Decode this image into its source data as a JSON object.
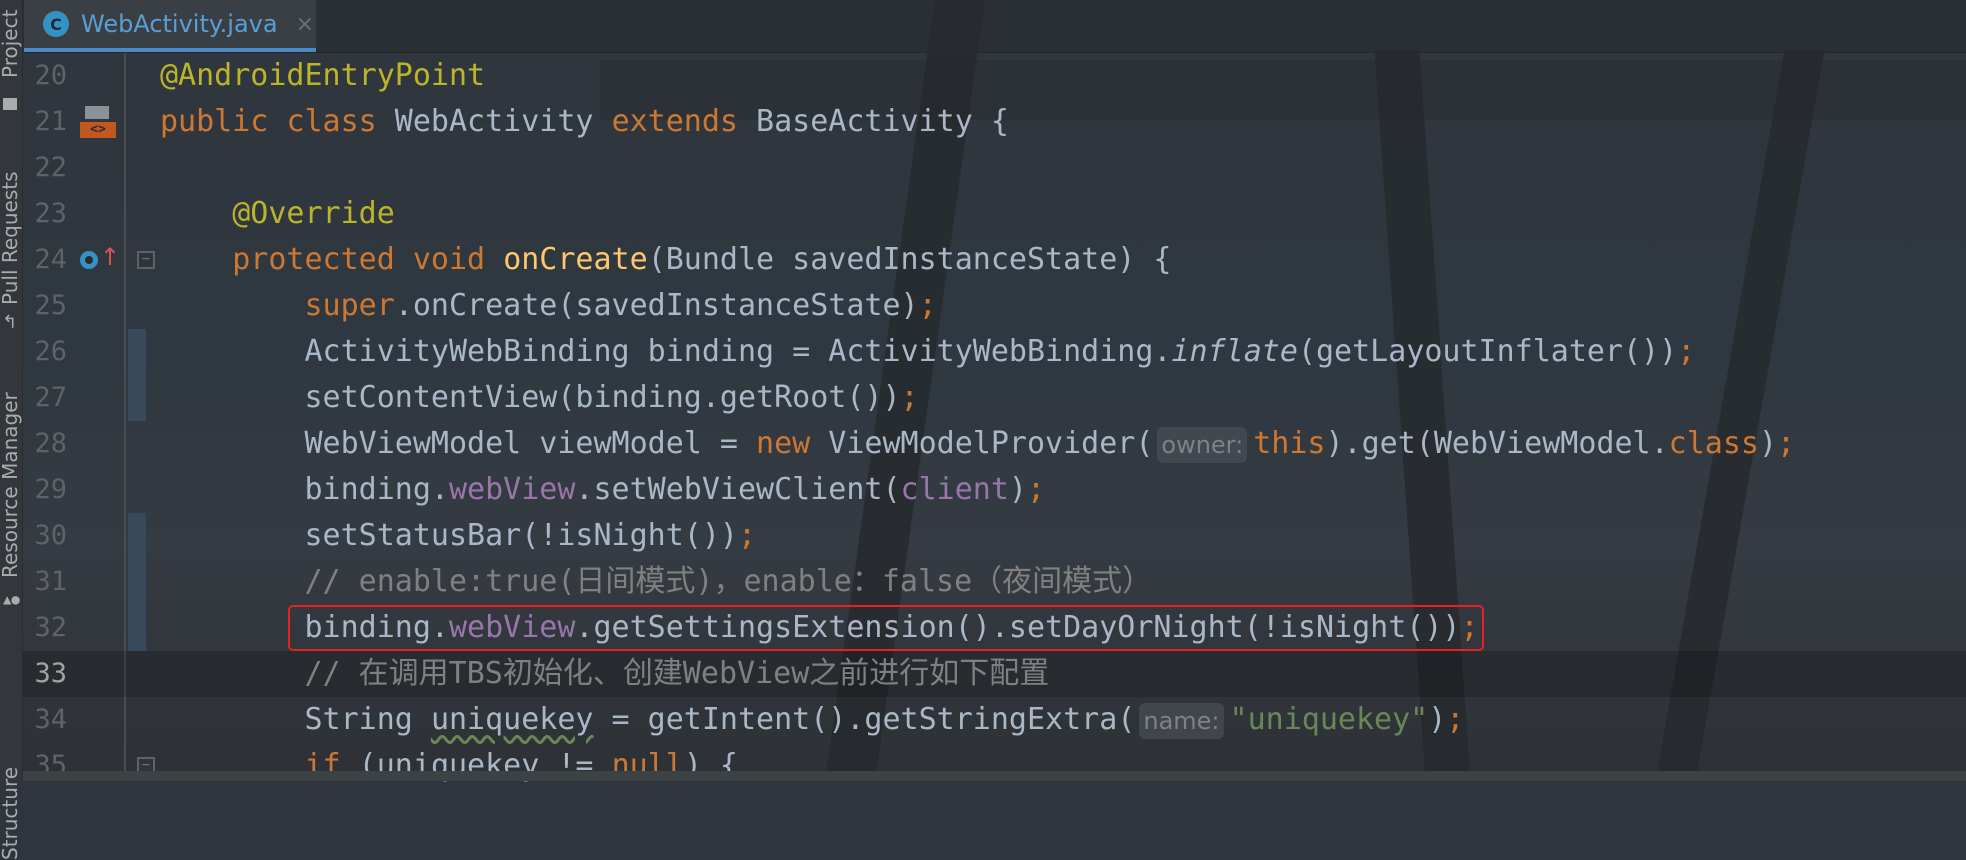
{
  "sidebar": {
    "items": [
      {
        "label": "Project",
        "icon": "folder-icon"
      },
      {
        "label": "Pull Requests",
        "icon": "pull-request-icon"
      },
      {
        "label": "Resource Manager",
        "icon": "resource-manager-icon"
      },
      {
        "label": "Structure",
        "icon": "structure-icon"
      }
    ]
  },
  "tab": {
    "label": "WebActivity.java",
    "icon_letter": "C",
    "close": "×"
  },
  "colors": {
    "annotation": "#bbb529",
    "keyword": "#cc7832",
    "plain": "#a9b7c6",
    "field": "#9876aa",
    "method": "#ffc66d",
    "comment": "#808080",
    "string": "#6a8759",
    "highlight_box": "#e82020",
    "tab_accent": "#4a88c7"
  },
  "current_line": 33,
  "highlighted_line": 32,
  "code": [
    {
      "n": "20",
      "tokens": [
        {
          "t": "@AndroidEntryPoint",
          "c": "ann"
        }
      ]
    },
    {
      "n": "21",
      "gutter": "implemented-icon",
      "tokens": [
        {
          "t": "public",
          "c": "kw"
        },
        {
          "t": " "
        },
        {
          "t": "class",
          "c": "kw"
        },
        {
          "t": " WebActivity "
        },
        {
          "t": "extends",
          "c": "kw"
        },
        {
          "t": " BaseActivity {"
        }
      ]
    },
    {
      "n": "22",
      "tokens": []
    },
    {
      "n": "23",
      "tokens": [
        {
          "t": "    "
        },
        {
          "t": "@Override",
          "c": "ann"
        }
      ]
    },
    {
      "n": "24",
      "gutter": "overrides-method-icon",
      "fold": true,
      "tokens": [
        {
          "t": "    "
        },
        {
          "t": "protected",
          "c": "kw"
        },
        {
          "t": " "
        },
        {
          "t": "void",
          "c": "kw"
        },
        {
          "t": " "
        },
        {
          "t": "onCreate",
          "c": "method"
        },
        {
          "t": "(Bundle savedInstanceState) {"
        }
      ]
    },
    {
      "n": "25",
      "tokens": [
        {
          "t": "        "
        },
        {
          "t": "super",
          "c": "kw"
        },
        {
          "t": ".onCreate(savedInstanceState)"
        },
        {
          "t": ";",
          "c": "kw"
        }
      ]
    },
    {
      "n": "26",
      "changed": true,
      "tokens": [
        {
          "t": "        ActivityWebBinding binding = ActivityWebBinding."
        },
        {
          "t": "inflate",
          "c": "italic"
        },
        {
          "t": "(getLayoutInflater())"
        },
        {
          "t": ";",
          "c": "kw"
        }
      ]
    },
    {
      "n": "27",
      "changed": true,
      "tokens": [
        {
          "t": "        setContentView(binding.getRoot())"
        },
        {
          "t": ";",
          "c": "kw"
        }
      ]
    },
    {
      "n": "28",
      "tokens": [
        {
          "t": "        WebViewModel viewModel = "
        },
        {
          "t": "new",
          "c": "kw"
        },
        {
          "t": " ViewModelProvider("
        },
        {
          "t": "owner:",
          "c": "hint"
        },
        {
          "t": "this",
          "c": "kw"
        },
        {
          "t": ").get(WebViewModel."
        },
        {
          "t": "class",
          "c": "kw"
        },
        {
          "t": ")"
        },
        {
          "t": ";",
          "c": "kw"
        }
      ]
    },
    {
      "n": "29",
      "tokens": [
        {
          "t": "        binding."
        },
        {
          "t": "webView",
          "c": "field"
        },
        {
          "t": ".setWebViewClient("
        },
        {
          "t": "client",
          "c": "field"
        },
        {
          "t": ")"
        },
        {
          "t": ";",
          "c": "kw"
        }
      ]
    },
    {
      "n": "30",
      "changed": true,
      "tokens": [
        {
          "t": "        setStatusBar(!isNight())"
        },
        {
          "t": ";",
          "c": "kw"
        }
      ]
    },
    {
      "n": "31",
      "changed": true,
      "tokens": [
        {
          "t": "        "
        },
        {
          "t": "// enable:true(日间模式)，enable：false（夜间模式）",
          "c": "comment"
        }
      ]
    },
    {
      "n": "32",
      "changed": true,
      "tokens": [
        {
          "t": "        binding."
        },
        {
          "t": "webView",
          "c": "field"
        },
        {
          "t": ".getSettingsExtension().setDayOrNight(!isNight())"
        },
        {
          "t": ";",
          "c": "kw"
        }
      ]
    },
    {
      "n": "33",
      "tokens": [
        {
          "t": "        "
        },
        {
          "t": "// 在调用TBS初始化、创建WebView之前进行如下配置",
          "c": "comment"
        }
      ]
    },
    {
      "n": "34",
      "tokens": [
        {
          "t": "        String "
        },
        {
          "t": "uniquekey",
          "c": "wavy"
        },
        {
          "t": " = getIntent().getStringExtra("
        },
        {
          "t": "name:",
          "c": "hint"
        },
        {
          "t": "\"uniquekey\"",
          "c": "string"
        },
        {
          "t": ")"
        },
        {
          "t": ";",
          "c": "kw"
        }
      ]
    },
    {
      "n": "35",
      "fold": true,
      "tokens": [
        {
          "t": "        "
        },
        {
          "t": "if",
          "c": "kw"
        },
        {
          "t": " (uniquekey != "
        },
        {
          "t": "null",
          "c": "kw"
        },
        {
          "t": ") {"
        }
      ]
    }
  ]
}
